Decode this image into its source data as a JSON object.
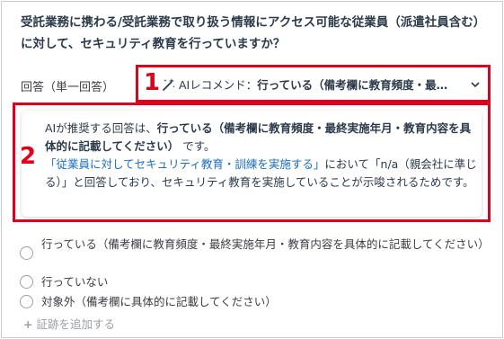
{
  "question": {
    "line1": "受託業務に携わる/受託業務で取り扱う情報にアクセス可能な従業員（派遣社員含む）",
    "line2": "に対して、セキュリティ教育を行っていますか？"
  },
  "answer_label": "回答（単一回答）",
  "dropdown": {
    "number": "1",
    "icon": "magic-wand-icon",
    "prefix": "AIレコメンド：",
    "value": "行っている（備考欄に教育頻度・最…",
    "chevron": "chevron-down-icon"
  },
  "recommendation": {
    "number": "2",
    "t1": "AIが推奨する回答は、",
    "t2": "行っている（備考欄に教育頻度・最終実施年月・教育内容を具体的に記載してください）",
    "t3": "です。",
    "t4": "「従業員に対してセキュリティ教育・訓練を実施する」",
    "t5": "において「n/a（親会社に準じる）」と回答しており、セキュリティ教育を実施していることが示唆されるためです。"
  },
  "options": [
    {
      "label": "行っている（備考欄に教育頻度・最終実施年月・教育内容を具体的に記載してください）"
    },
    {
      "label": "行っていない"
    },
    {
      "label": "対象外（備考欄に具体的に記載してください）"
    }
  ],
  "add_evidence": "証跡を追加する",
  "colors": {
    "highlight": "#e3001b",
    "link": "#1a6fc4"
  }
}
